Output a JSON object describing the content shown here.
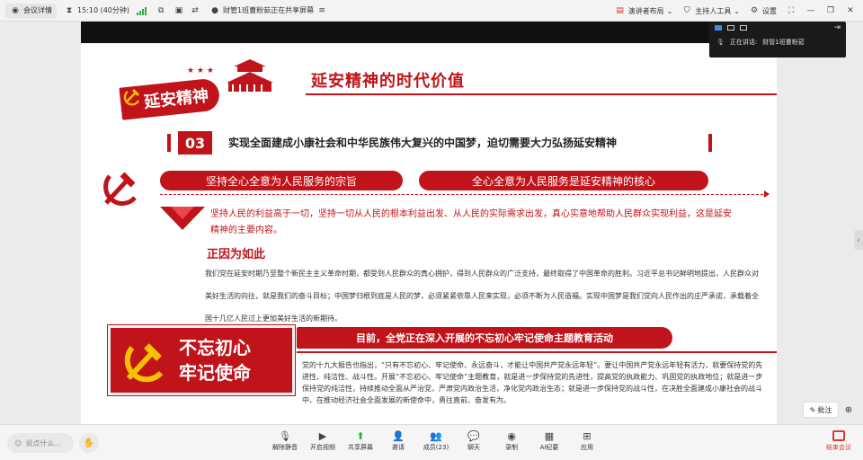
{
  "topbar": {
    "meeting_details": "会议详情",
    "time": "15:10 (40分钟)",
    "sharing_status": "财管1班曹粉茹正在共享屏幕",
    "speaker_layout": "演讲者布局",
    "host_tools": "主持人工具",
    "settings": "设置"
  },
  "presenter": {
    "speaking_label": "正在讲话:",
    "speaking_name": "财管1班曹粉茹"
  },
  "slide": {
    "banner": "延安精神",
    "title": "延安精神的时代价值",
    "section_number": "03",
    "section_title": "实现全面建成小康社会和中华民族伟大复兴的中国梦，迫切需要大力弘扬延安精神",
    "pill_left": "坚持全心全意为人民服务的宗旨",
    "pill_right": "全心全意为人民服务是延安精神的核心",
    "red_para": "坚持人民的利益高于一切，坚持一切从人民的根本利益出发、从人民的实际需求出发，真心实意地帮助人民群众实现利益，这是延安精神的主要内容。",
    "sub_heading": "正因为如此",
    "body_para": "我们党在延安时期乃至整个新民主主义革命时期，都受到人民群众的真心拥护，得到人民群众的广泛支持，最终取得了中国革命的胜利。习近平总书记鲜明地提出，人民群众对美好生活的向往，就是我们的奋斗目标；中国梦归根到底是人民的梦，必须紧紧依靠人民来实现，必须不断为人民造福。实现中国梦是我们党向人民作出的庄严承诺，承载着全国十几亿人民过上更加美好生活的新期待。",
    "big_block_line1": "不忘初心",
    "big_block_line2": "牢记使命",
    "theme_bar": "目前，全党正在深入开展的不忘初心牢记使命主题教育活动",
    "small_para": "党的十九大报告也指出，“只有不忘初心、牢记使命、永远奋斗，才能让中国共产党永远年轻”。要让中国共产党永远年轻有活力，就要保持党的先进性、纯洁性、战斗性。开展“不忘初心、牢记使命”主题教育，就是进一步保持党的先进性，提高党的执政能力、巩固党的执政地位；就是进一步保持党的纯洁性，持续推动全面从严治党，严肃党内政治生活，净化党内政治生态；就是进一步保持党的战斗性，在决胜全面建成小康社会的战斗中、在推动经济社会全面发展的新使命中，勇往直前、奋发有为。"
  },
  "bottombar": {
    "chat_placeholder": "说点什么...",
    "tools": [
      {
        "label": "解除静音",
        "icon": "mic-muted-icon"
      },
      {
        "label": "开启视频",
        "icon": "camera-off-icon"
      },
      {
        "label": "共享屏幕",
        "icon": "share-screen-icon"
      },
      {
        "label": "邀请",
        "icon": "invite-icon"
      },
      {
        "label": "成员(23)",
        "icon": "members-icon"
      },
      {
        "label": "聊天",
        "icon": "chat-icon"
      },
      {
        "label": "录制",
        "icon": "record-icon"
      },
      {
        "label": "AI纪要",
        "icon": "ai-notes-icon"
      },
      {
        "label": "应用",
        "icon": "apps-icon"
      }
    ],
    "end_meeting": "结束会议"
  },
  "floating": {
    "annotate": "批注"
  },
  "colors": {
    "brand_red": "#c0141a",
    "signal_green": "#2faa4a",
    "end_red": "#e03a2e"
  }
}
